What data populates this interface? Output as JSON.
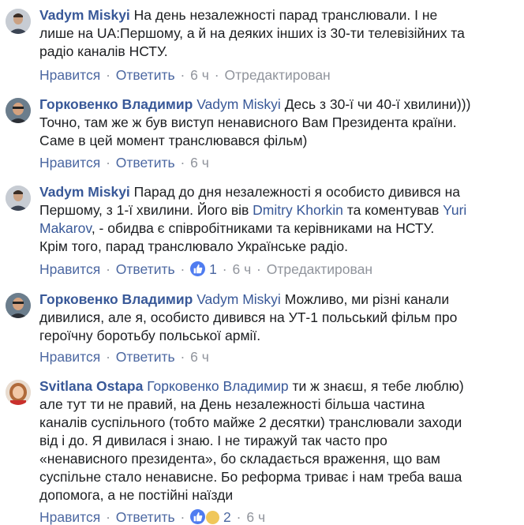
{
  "comments": [
    {
      "author": "Vadym Miskyi",
      "lines": [
        [
          {
            "t": "На день незалежності парад транслювали. І не"
          }
        ],
        [
          {
            "t": "лише на UA:Першому, а й на деяких інших із 30-ти телевізійних та"
          }
        ],
        [
          {
            "t": "радіо каналів НСТУ."
          }
        ]
      ],
      "actions": {
        "like": "Нравится",
        "reply": "Ответить",
        "time": "6 ч",
        "edited": "Отредактирован"
      }
    },
    {
      "author": "Горковенко Владимир",
      "lines": [
        [
          {
            "t": "Vadym Miskyi",
            "m": true
          },
          {
            "t": " Десь з 30-ї чи 40-ї хвилини)))"
          }
        ],
        [
          {
            "t": "Точно, там же ж був виступ ненависного Вам Президента країни."
          }
        ],
        [
          {
            "t": "Саме в цей момент транслювався фільм)"
          }
        ]
      ],
      "actions": {
        "like": "Нравится",
        "reply": "Ответить",
        "time": "6 ч"
      }
    },
    {
      "author": "Vadym Miskyi",
      "lines": [
        [
          {
            "t": "Парад до дня незалежності я особисто дивився на"
          }
        ],
        [
          {
            "t": "Першому, з 1-ї хвилини. Його вів "
          },
          {
            "t": "Dmitry Khorkin",
            "m": true
          },
          {
            "t": " та коментував "
          },
          {
            "t": "Yuri",
            "m": true
          }
        ],
        [
          {
            "t": "Makarov",
            "m": true
          },
          {
            "t": ", - обидва є співробітниками та керівниками на НСТУ."
          }
        ],
        [
          {
            "t": "Крім того, парад транслювало Українське радіо."
          }
        ]
      ],
      "actions": {
        "like": "Нравится",
        "reply": "Ответить",
        "likes": "1",
        "time": "6 ч",
        "edited": "Отредактирован"
      }
    },
    {
      "author": "Горковенко Владимир",
      "lines": [
        [
          {
            "t": "Vadym Miskyi",
            "m": true
          },
          {
            "t": " Можливо, ми різні канали"
          }
        ],
        [
          {
            "t": "дивилися, але я, особисто дивився на УТ-1 польський фільм про"
          }
        ],
        [
          {
            "t": "героїчну боротьбу польської армії."
          }
        ]
      ],
      "actions": {
        "like": "Нравится",
        "reply": "Ответить",
        "time": "6 ч"
      }
    },
    {
      "author": "Svitlana Ostapa",
      "lines": [
        [
          {
            "t": "Горковенко Владимир",
            "m": true
          },
          {
            "t": " ти ж знаєш, я тебе люблю)"
          }
        ],
        [
          {
            "t": "але тут ти не правий, на День незалежності більша частина"
          }
        ],
        [
          {
            "t": "каналів суспільного (тобто майже 2 десятки) транслювали заходи"
          }
        ],
        [
          {
            "t": "від і до. Я дивилася і знаю. І не тиражуй так часто про"
          }
        ],
        [
          {
            "t": "«ненависного президента», бо складається враження, що вам"
          }
        ],
        [
          {
            "t": "суспільне стало ненависне. Бо реформа триває і нам треба ваша"
          }
        ],
        [
          {
            "t": "допомога, а не постійні наїзди"
          }
        ]
      ],
      "actions": {
        "like": "Нравится",
        "reply": "Ответить",
        "likes": "2",
        "time": "6 ч"
      }
    }
  ]
}
